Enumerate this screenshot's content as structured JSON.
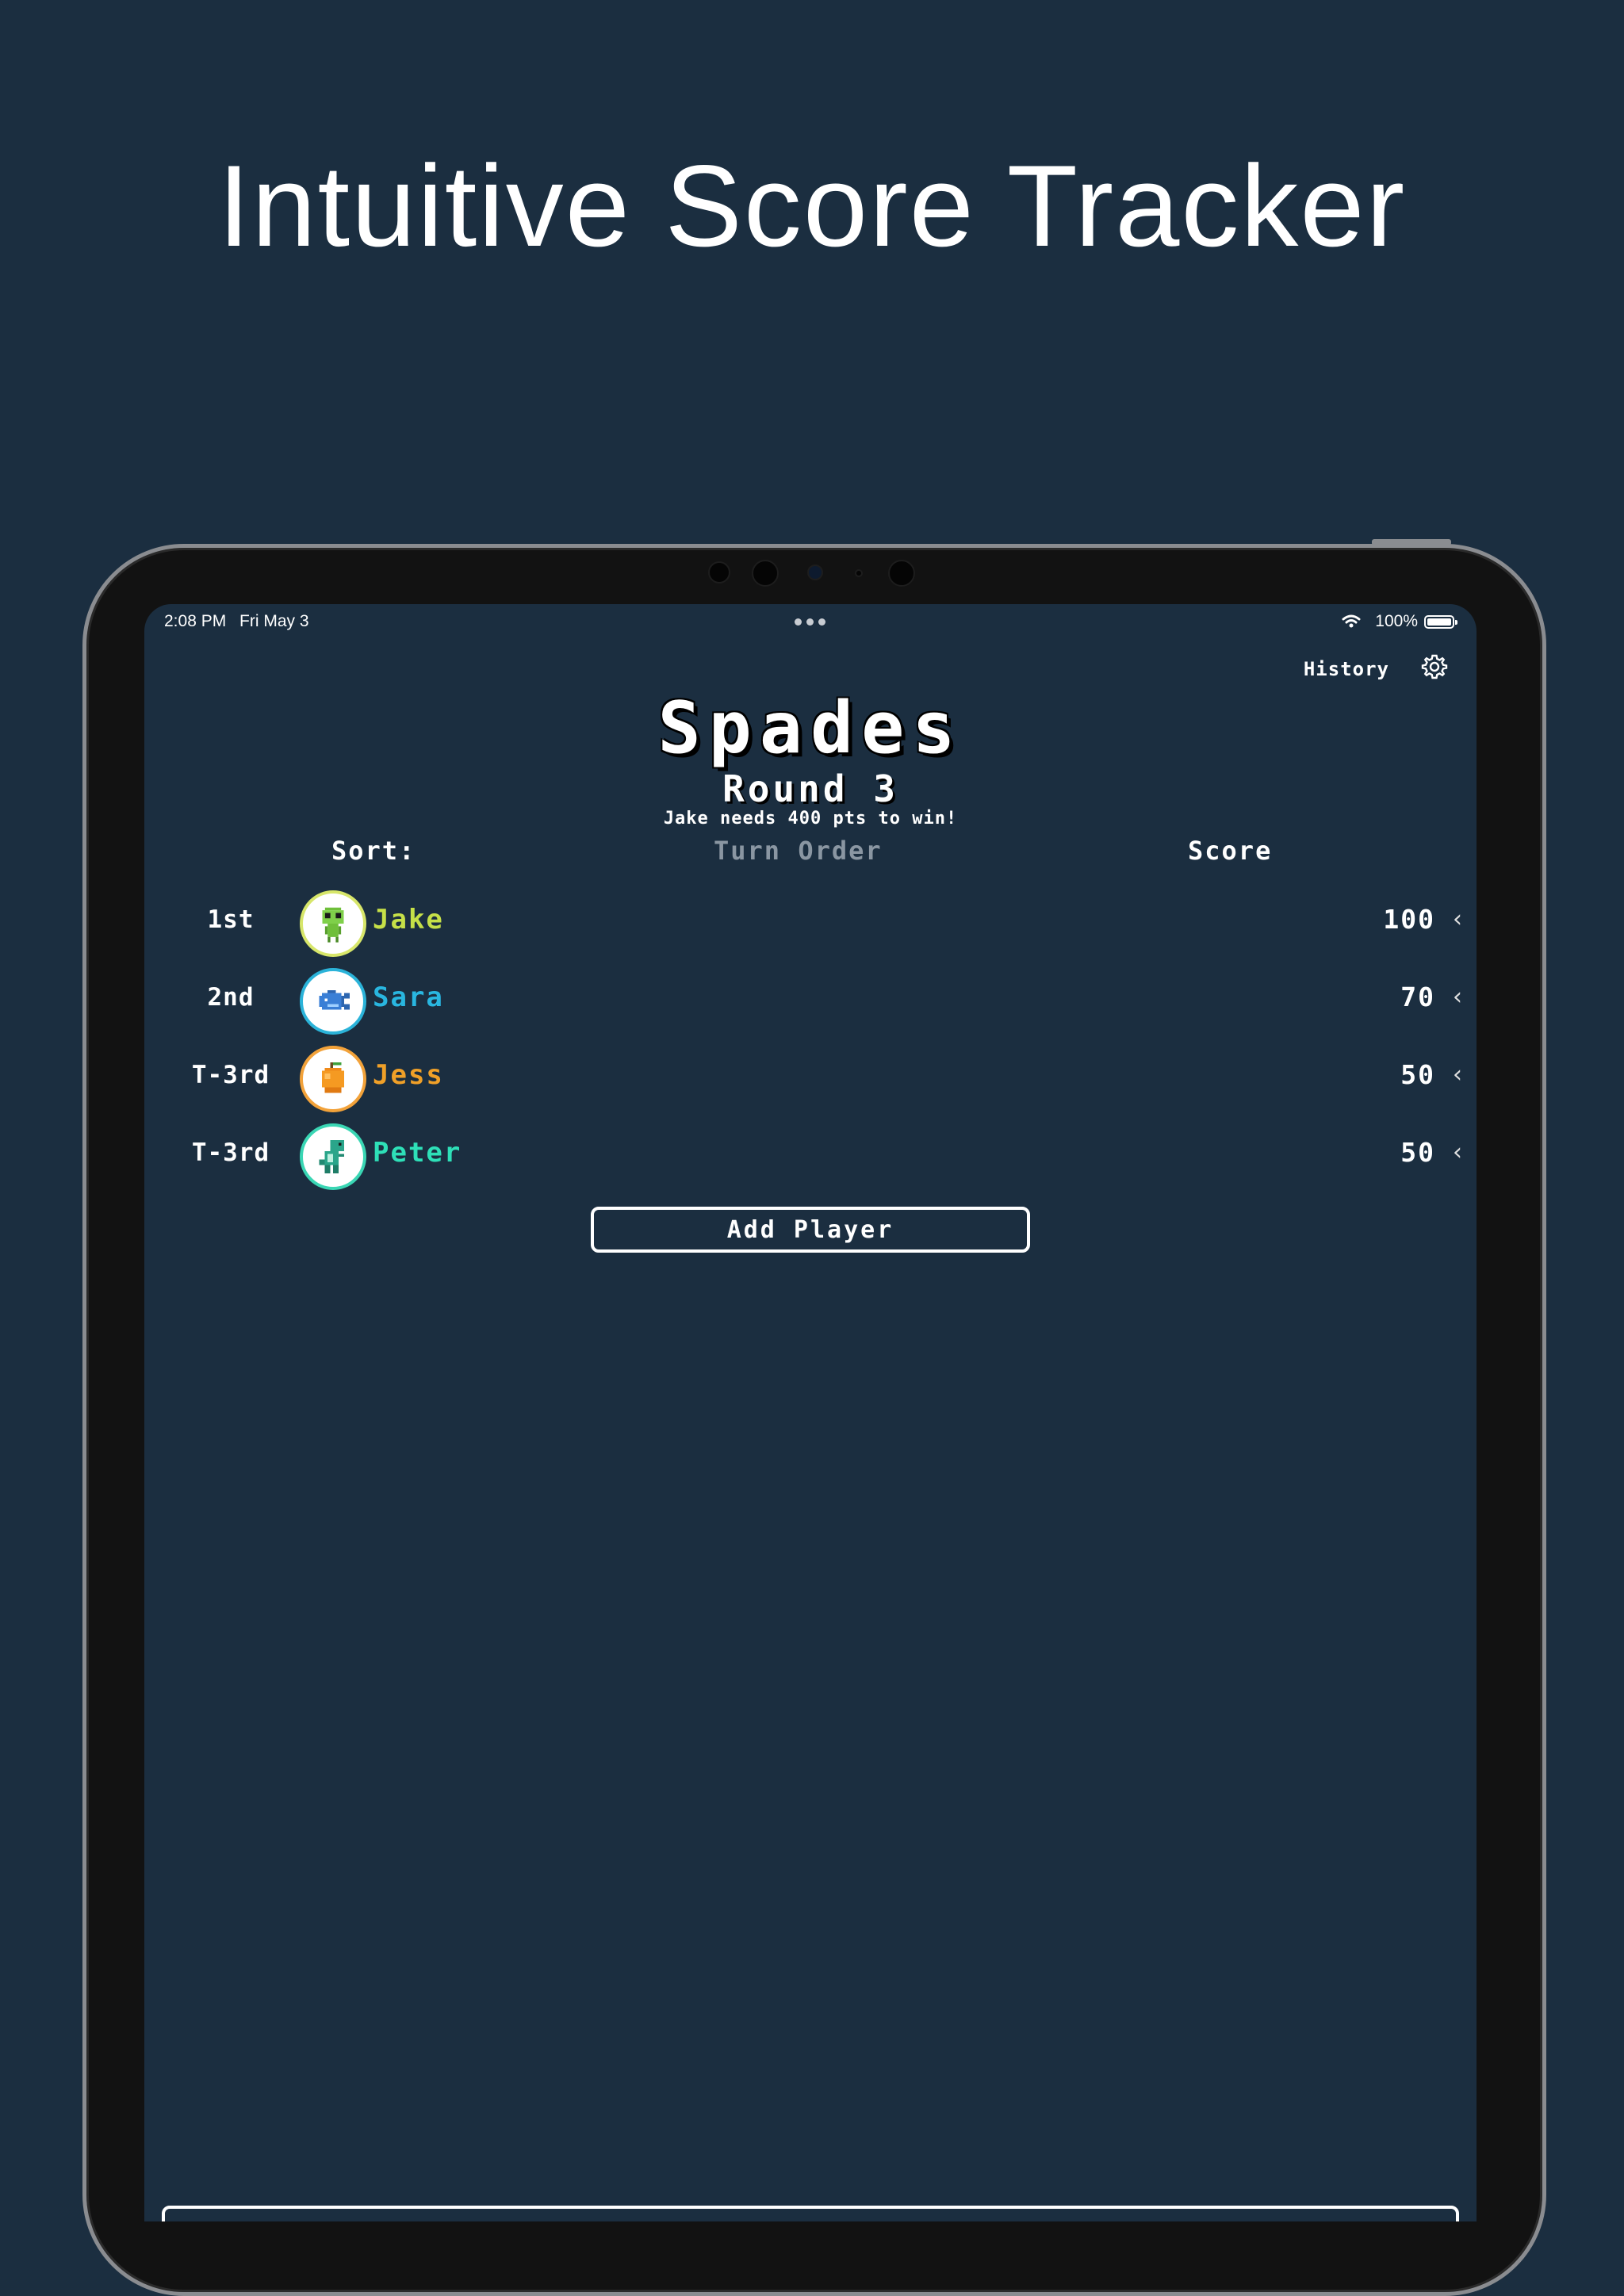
{
  "headline": "Intuitive Score Tracker",
  "status_bar": {
    "time": "2:08 PM",
    "date": "Fri May 3",
    "battery": "100%",
    "battery_level": 1.0
  },
  "header": {
    "history_label": "History",
    "settings_icon": "gear-icon"
  },
  "game": {
    "title": "Spades",
    "round": "Round 3",
    "subtitle": "Jake needs 400 pts to win!"
  },
  "sort": {
    "label": "Sort:",
    "options": [
      {
        "label": "Turn Order",
        "active": false
      },
      {
        "label": "Score",
        "active": true
      }
    ]
  },
  "players": [
    {
      "rank": "1st",
      "name": "Jake",
      "score": "100",
      "color": "#c6e048",
      "ring": "#d7e66a",
      "avatar_icon": "alien-icon"
    },
    {
      "rank": "2nd",
      "name": "Sara",
      "score": "70",
      "color": "#29b6e0",
      "ring": "#2bb3d9",
      "avatar_icon": "fish-icon"
    },
    {
      "rank": "T-3rd",
      "name": "Jess",
      "score": "50",
      "color": "#f0a028",
      "ring": "#f2a23a",
      "avatar_icon": "orange-icon"
    },
    {
      "rank": "T-3rd",
      "name": "Peter",
      "score": "50",
      "color": "#2ee0b8",
      "ring": "#3ad6b4",
      "avatar_icon": "dinosaur-icon"
    }
  ],
  "actions": {
    "add_player": "Add Player"
  },
  "colors": {
    "background": "#1b2e40",
    "inactive_sort": "#8a96a2"
  }
}
